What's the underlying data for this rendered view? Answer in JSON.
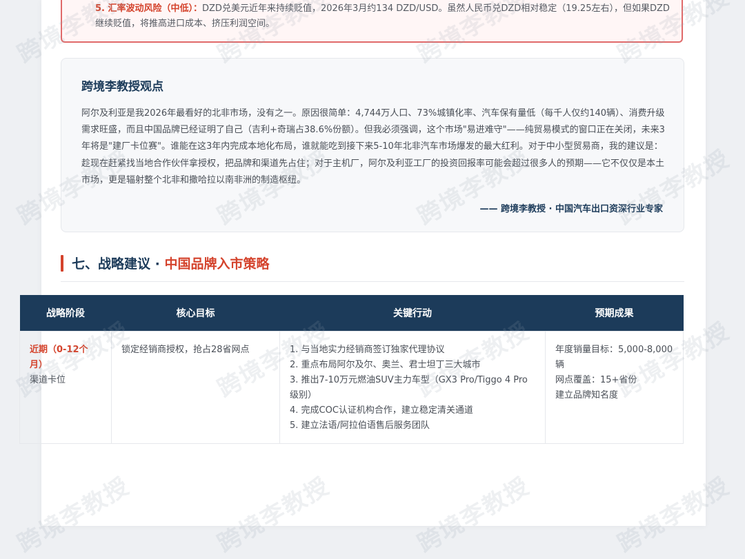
{
  "risk": {
    "title": "5. 汇率波动风险（中低）：",
    "text": "DZD兑美元近年来持续贬值，2026年3月约134 DZD/USD。虽然人民币兑DZD相对稳定（19.25左右），但如果DZD继续贬值，将推高进口成本、挤压利润空间。"
  },
  "opinion": {
    "title": "跨境李教授观点",
    "body": "阿尔及利亚是我2026年最看好的北非市场，没有之一。原因很简单：4,744万人口、73%城镇化率、汽车保有量低（每千人仅约140辆）、消费升级需求旺盛，而且中国品牌已经证明了自己（吉利+奇瑞占38.6%份额）。但我必须强调，这个市场\"易进难守\"——纯贸易模式的窗口正在关闭，未来3年将是\"建厂卡位赛\"。谁能在这3年内完成本地化布局，谁就能吃到接下来5-10年北非汽车市场爆发的最大红利。对于中小型贸易商，我的建议是：趁现在赶紧找当地合作伙伴拿授权，把品牌和渠道先占住；对于主机厂，阿尔及利亚工厂的投资回报率可能会超过很多人的预期——它不仅仅是本土市场，更是辐射整个北非和撒哈拉以南非洲的制造枢纽。",
    "signature": "—— 跨境李教授 · 中国汽车出口资深行业专家"
  },
  "section": {
    "title_main": "七、战略建议 · ",
    "title_highlight": "中国品牌入市策略"
  },
  "table": {
    "headers": [
      "战略阶段",
      "核心目标",
      "关键行动",
      "预期成果"
    ],
    "rows": [
      {
        "phase_name": "近期（0-12个月）",
        "phase_sub": "渠道卡位",
        "goal": "锁定经销商授权，抢占28省网点",
        "actions": [
          "1. 与当地实力经销商签订独家代理协议",
          "2. 重点布局阿尔及尔、奥兰、君士坦丁三大城市",
          "3. 推出7-10万元燃油SUV主力车型（GX3 Pro/Tiggo 4 Pro级别）",
          "4. 完成COC认证机构合作，建立稳定清关通道",
          "5. 建立法语/阿拉伯语售后服务团队"
        ],
        "results": [
          "年度销量目标：5,000-8,000辆",
          "网点覆盖：15+省份",
          "建立品牌知名度"
        ]
      }
    ]
  },
  "watermark": "跨境李教授",
  "colors": {
    "accent": "#d4432c",
    "navy": "#1c3b5a"
  }
}
